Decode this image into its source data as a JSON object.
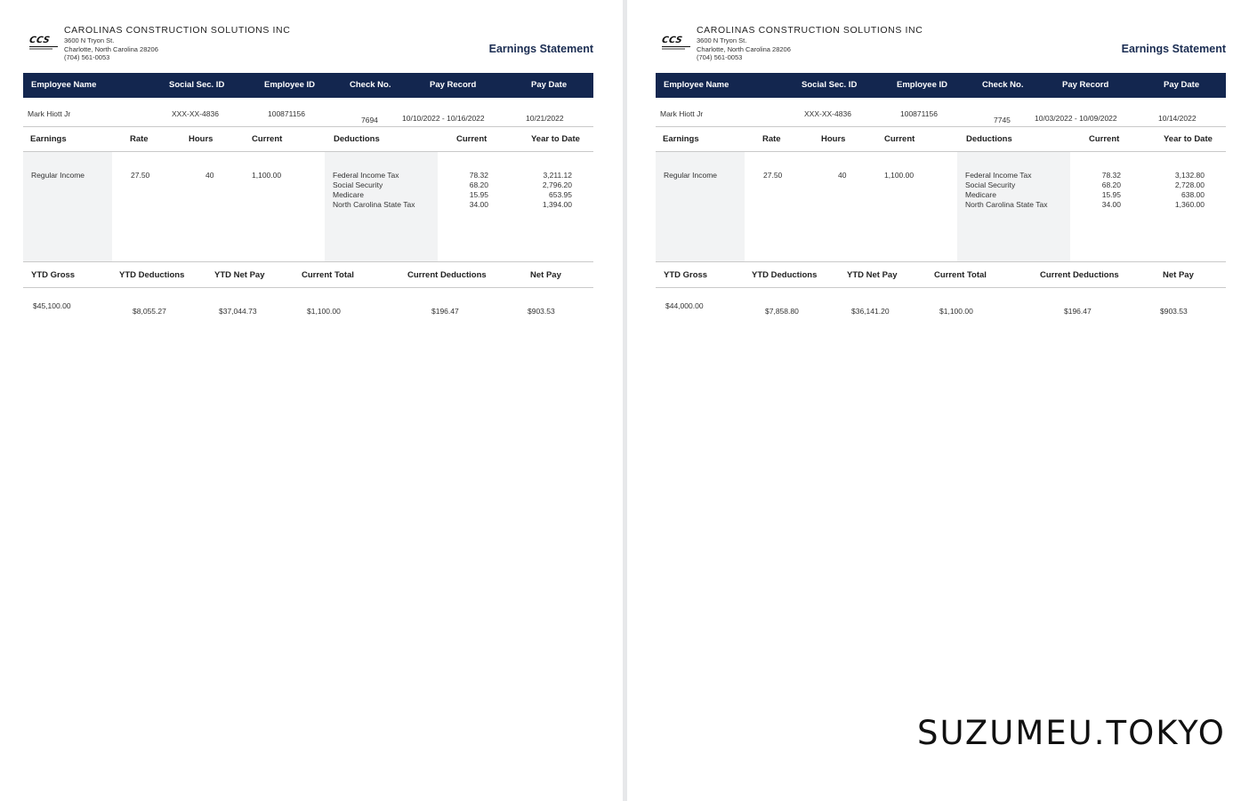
{
  "statements": [
    {
      "company": {
        "logo_text": "CCS",
        "name": "CAROLINAS CONSTRUCTION SOLUTIONS INC",
        "address1": "3600 N Tryon St.",
        "address2": "Charlotte, North Carolina 28206",
        "phone": "(704) 561-0053"
      },
      "title": "Earnings Statement",
      "header_labels": [
        "Employee Name",
        "Social Sec. ID",
        "Employee ID",
        "Check No.",
        "Pay Record",
        "Pay Date"
      ],
      "employee": {
        "name": "Mark Hiott Jr",
        "ssn": "XXX-XX-4836",
        "employee_id": "100871156",
        "check_no": "7694",
        "pay_record": "10/10/2022 - 10/16/2022",
        "pay_date": "10/21/2022"
      },
      "section_labels": [
        "Earnings",
        "Rate",
        "Hours",
        "Current",
        "Deductions",
        "Current",
        "Year to Date"
      ],
      "earnings": {
        "label": "Regular Income",
        "rate": "27.50",
        "hours": "40",
        "current": "1,100.00"
      },
      "deductions": [
        {
          "label": "Federal Income Tax",
          "current": "78.32",
          "ytd": "3,211.12"
        },
        {
          "label": "Social Security",
          "current": "68.20",
          "ytd": "2,796.20"
        },
        {
          "label": "Medicare",
          "current": "15.95",
          "ytd": "653.95"
        },
        {
          "label": "North Carolina State Tax",
          "current": "34.00",
          "ytd": "1,394.00"
        }
      ],
      "totals_labels": [
        "YTD Gross",
        "YTD Deductions",
        "YTD Net Pay",
        "Current Total",
        "Current Deductions",
        "Net Pay"
      ],
      "totals": {
        "ytd_gross": "$45,100.00",
        "ytd_deductions": "$8,055.27",
        "ytd_net_pay": "$37,044.73",
        "current_total": "$1,100.00",
        "current_deductions": "$196.47",
        "net_pay": "$903.53"
      }
    },
    {
      "company": {
        "logo_text": "CCS",
        "name": "CAROLINAS CONSTRUCTION SOLUTIONS INC",
        "address1": "3600 N Tryon St.",
        "address2": "Charlotte, North Carolina 28206",
        "phone": "(704) 561-0053"
      },
      "title": "Earnings Statement",
      "header_labels": [
        "Employee Name",
        "Social Sec. ID",
        "Employee ID",
        "Check No.",
        "Pay Record",
        "Pay Date"
      ],
      "employee": {
        "name": "Mark Hiott Jr",
        "ssn": "XXX-XX-4836",
        "employee_id": "100871156",
        "check_no": "7745",
        "pay_record": "10/03/2022 - 10/09/2022",
        "pay_date": "10/14/2022"
      },
      "section_labels": [
        "Earnings",
        "Rate",
        "Hours",
        "Current",
        "Deductions",
        "Current",
        "Year to Date"
      ],
      "earnings": {
        "label": "Regular Income",
        "rate": "27.50",
        "hours": "40",
        "current": "1,100.00"
      },
      "deductions": [
        {
          "label": "Federal Income Tax",
          "current": "78.32",
          "ytd": "3,132.80"
        },
        {
          "label": "Social Security",
          "current": "68.20",
          "ytd": "2,728.00"
        },
        {
          "label": "Medicare",
          "current": "15.95",
          "ytd": "638.00"
        },
        {
          "label": "North Carolina State Tax",
          "current": "34.00",
          "ytd": "1,360.00"
        }
      ],
      "totals_labels": [
        "YTD Gross",
        "YTD Deductions",
        "YTD Net Pay",
        "Current Total",
        "Current Deductions",
        "Net Pay"
      ],
      "totals": {
        "ytd_gross": "$44,000.00",
        "ytd_deductions": "$7,858.80",
        "ytd_net_pay": "$36,141.20",
        "current_total": "$1,100.00",
        "current_deductions": "$196.47",
        "net_pay": "$903.53"
      }
    }
  ],
  "watermark": "SUZUMEU.TOKYO"
}
